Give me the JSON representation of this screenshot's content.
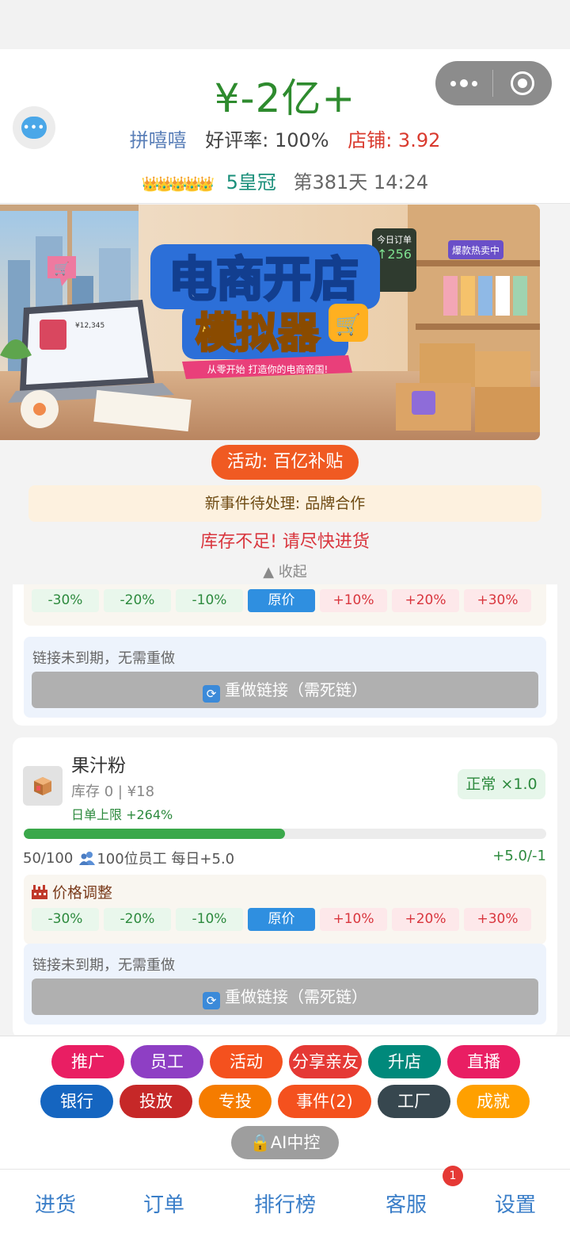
{
  "header": {
    "money": "¥-2亿+",
    "shop_name": "拼嘻嘻",
    "rating": "好评率: 100%",
    "store_score": "店铺: 3.92",
    "crowns": "👑👑👑👑👑",
    "crown_level": "5皇冠",
    "day_time": "第381天 14:24"
  },
  "banner": {
    "title_line1": "电商开店",
    "title_line2": "模拟器",
    "subtitle": "从零开始 打造你的电商帝国!",
    "orders_label": "今日订单",
    "orders_value": "↑256",
    "hot_label": "爆款热卖中",
    "laptop_price": "¥12,345"
  },
  "notices": {
    "activity": "活动: 百亿补贴",
    "event": "新事件待处理: 品牌合作",
    "stock_warning": "库存不足! 请尽快进货",
    "collapse": "▲ 收起"
  },
  "price_panel": {
    "title": "价格调整",
    "buttons": [
      "-30%",
      "-20%",
      "-10%",
      "原价",
      "+10%",
      "+20%",
      "+30%"
    ]
  },
  "link_panel": {
    "note": "链接未到期，无需重做",
    "redo_label": "重做链接（需死链）"
  },
  "product": {
    "name": "果汁粉",
    "stock": "库存 0 | ¥18",
    "limit": "日单上限 +264%",
    "status": "正常 ×1.0",
    "progress": 0.5,
    "progress_text": "50/100",
    "staff": "100位员工 每日+5.0",
    "rate": "+5.0/-1"
  },
  "actions": {
    "row1": [
      {
        "label": "推广",
        "color": "#e91e63"
      },
      {
        "label": "员工",
        "color": "#8e3fc4"
      },
      {
        "label": "活动",
        "color": "#f4511e"
      },
      {
        "label": "分享亲友",
        "color": "#e53935"
      },
      {
        "label": "升店",
        "color": "#00897b"
      },
      {
        "label": "直播",
        "color": "#e91e63"
      }
    ],
    "row2": [
      {
        "label": "银行",
        "color": "#1565c0"
      },
      {
        "label": "投放",
        "color": "#c62828"
      },
      {
        "label": "专投",
        "color": "#f57c00"
      },
      {
        "label": "事件(2)",
        "color": "#f4511e"
      },
      {
        "label": "工厂",
        "color": "#37474f"
      },
      {
        "label": "成就",
        "color": "#ffa000"
      }
    ],
    "ai_label": "🔒AI中控",
    "ai_color": "#9e9e9e"
  },
  "tabs": [
    "进货",
    "订单",
    "排行榜",
    "客服",
    "设置"
  ],
  "service_badge": "1"
}
